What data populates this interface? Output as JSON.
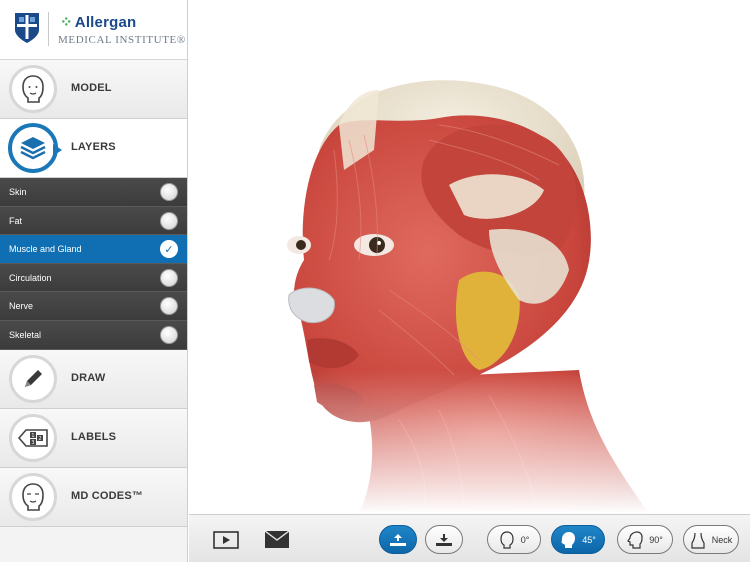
{
  "brand": {
    "name": "Allergan",
    "subtitle": "MEDICAL INSTITUTE®"
  },
  "sidebar": {
    "nav": [
      {
        "label": "MODEL",
        "icon": "head-outline-icon",
        "active": false
      },
      {
        "label": "LAYERS",
        "icon": "layers-stack-icon",
        "active": true
      },
      {
        "label": "DRAW",
        "icon": "pencil-icon",
        "active": false
      },
      {
        "label": "LABELS",
        "icon": "numbered-labels-icon",
        "active": false
      },
      {
        "label": "MD CODES™",
        "icon": "face-outline-icon",
        "active": false
      }
    ],
    "layers": [
      {
        "label": "Skin",
        "checked": false
      },
      {
        "label": "Fat",
        "checked": false
      },
      {
        "label": "Muscle and Gland",
        "checked": true
      },
      {
        "label": "Circulation",
        "checked": false
      },
      {
        "label": "Nerve",
        "checked": false
      },
      {
        "label": "Skeletal",
        "checked": false
      }
    ],
    "check_glyph": "✓"
  },
  "toolbar": {
    "play_icon": "play-icon",
    "mail_icon": "envelope-icon",
    "layer_up_icon": "layer-up-icon",
    "layer_down_icon": "layer-down-icon",
    "views": [
      {
        "label": "0°",
        "icon": "head-front-icon",
        "active": false
      },
      {
        "label": "45°",
        "icon": "head-45-icon",
        "active": true
      },
      {
        "label": "90°",
        "icon": "head-profile-icon",
        "active": false
      },
      {
        "label": "Neck",
        "icon": "neck-icon",
        "active": false
      }
    ]
  },
  "colors": {
    "accent": "#1a78b8",
    "selected_layer": "#0f6fb2",
    "muscle": "#c9463d"
  }
}
